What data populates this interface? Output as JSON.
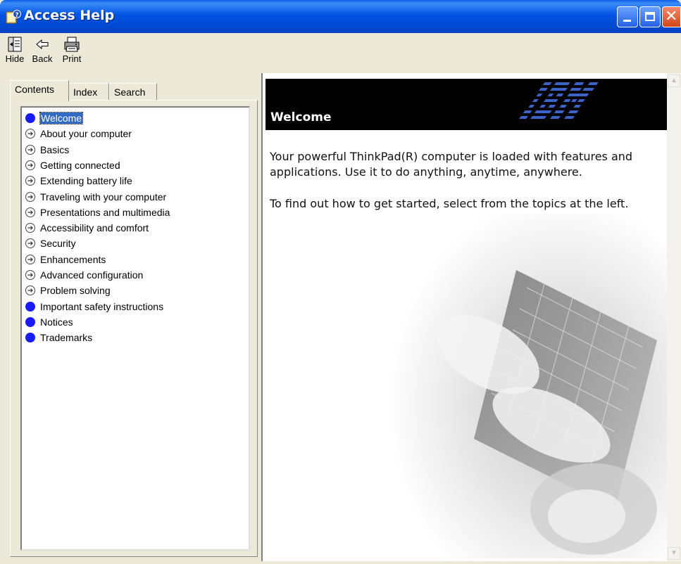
{
  "window": {
    "title": "Access Help"
  },
  "toolbar": {
    "hide_label": "Hide",
    "back_label": "Back",
    "print_label": "Print"
  },
  "tabs": [
    {
      "label": "Contents",
      "active": true
    },
    {
      "label": "Index",
      "active": false
    },
    {
      "label": "Search",
      "active": false
    }
  ],
  "tree": {
    "items": [
      {
        "label": "Welcome",
        "icon": "topic-page-icon",
        "selected": true
      },
      {
        "label": "About your computer",
        "icon": "expand-circle-icon"
      },
      {
        "label": "Basics",
        "icon": "expand-circle-icon"
      },
      {
        "label": "Getting connected",
        "icon": "expand-circle-icon"
      },
      {
        "label": "Extending battery life",
        "icon": "expand-circle-icon"
      },
      {
        "label": "Traveling with your computer",
        "icon": "expand-circle-icon"
      },
      {
        "label": "Presentations and multimedia",
        "icon": "expand-circle-icon"
      },
      {
        "label": "Accessibility and comfort",
        "icon": "expand-circle-icon"
      },
      {
        "label": "Security",
        "icon": "expand-circle-icon"
      },
      {
        "label": "Enhancements",
        "icon": "expand-circle-icon"
      },
      {
        "label": "Advanced configuration",
        "icon": "expand-circle-icon"
      },
      {
        "label": "Problem solving",
        "icon": "expand-circle-icon"
      },
      {
        "label": "Important safety instructions",
        "icon": "topic-page-icon"
      },
      {
        "label": "Notices",
        "icon": "topic-page-icon"
      },
      {
        "label": "Trademarks",
        "icon": "topic-page-icon"
      }
    ]
  },
  "content": {
    "banner_title": "Welcome",
    "paragraph1": "Your powerful ThinkPad(R) computer is loaded with features and applications. Use it to do anything, anytime, anywhere.",
    "paragraph2": "To find out how to get started, select from the topics at the left.",
    "logo_text": "IBM"
  },
  "colors": {
    "titlebar": "#0054e3",
    "selection": "#316ac5",
    "topic_dot": "#1a1aff",
    "chrome": "#ece9d8"
  }
}
